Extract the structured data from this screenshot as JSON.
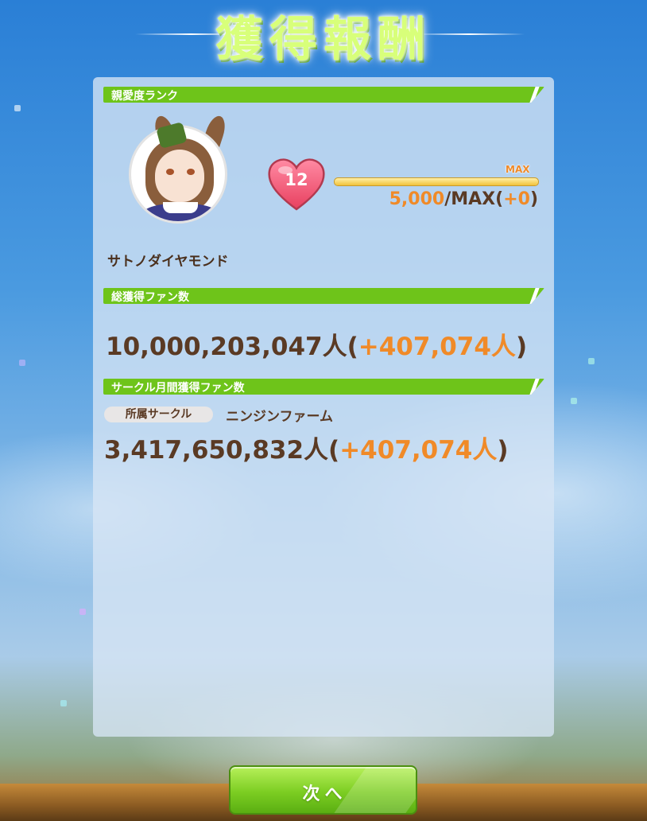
{
  "title": "獲得報酬",
  "bond_section": {
    "header": "親愛度ランク",
    "character_name": "サトノダイヤモンド",
    "rank": "12",
    "max_label": "MAX",
    "progress_fraction": 1.0,
    "points": "5,000",
    "separator": "/MAX(",
    "delta": "+0",
    "close": ")"
  },
  "fans_section": {
    "header": "総獲得ファン数",
    "total": "10,000,203,047人(",
    "delta": "+407,074人",
    "close": ")"
  },
  "circle_section": {
    "header": "サークル月間獲得ファン数",
    "affiliation_label": "所属サークル",
    "circle_name": "ニンジンファーム",
    "total": "3,417,650,832人(",
    "delta": "+407,074人",
    "close": ")"
  },
  "next_button": "次へ",
  "colors": {
    "section_green": "#6ec41a",
    "text_brown": "#5a3a24",
    "accent_orange": "#f08a28",
    "heart_pink": "#f25a78"
  }
}
